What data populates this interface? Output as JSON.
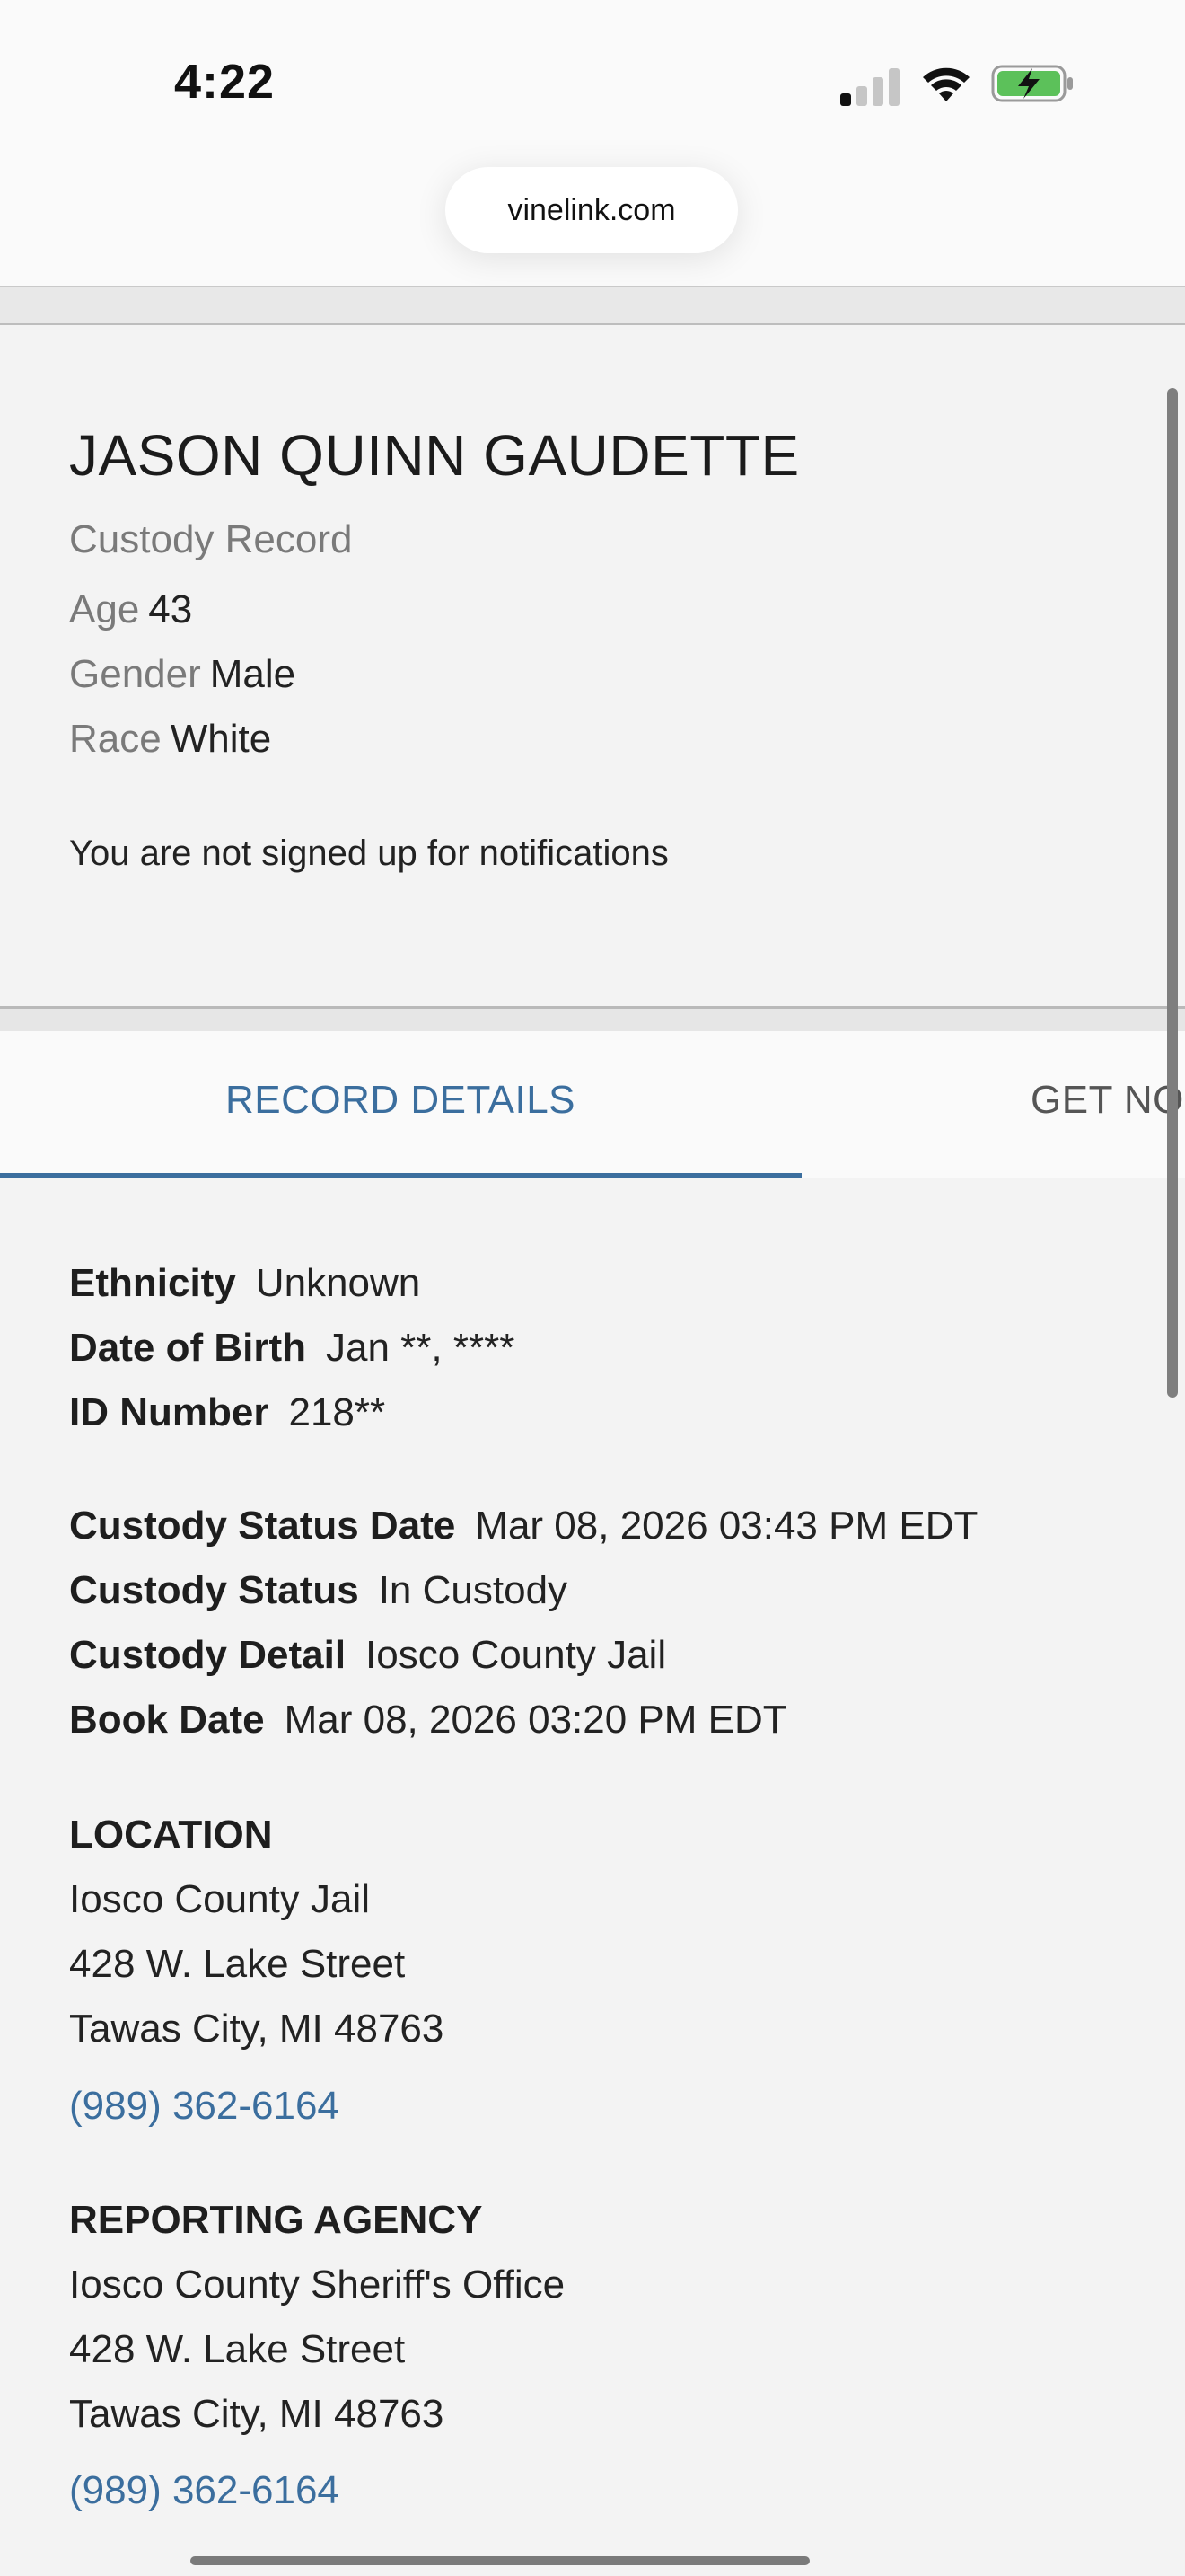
{
  "status_bar": {
    "time": "4:22"
  },
  "browser": {
    "url": "vinelink.com"
  },
  "record": {
    "name": "JASON QUINN GAUDETTE",
    "subtitle": "Custody Record",
    "age_label": "Age",
    "age_value": "43",
    "gender_label": "Gender",
    "gender_value": "Male",
    "race_label": "Race",
    "race_value": "White",
    "notice": "You are not signed up for notifications"
  },
  "tabs": [
    {
      "label": "RECORD DETAILS",
      "active": true
    },
    {
      "label": "GET NO"
    }
  ],
  "details": {
    "ethnicity_label": "Ethnicity",
    "ethnicity_value": "Unknown",
    "dob_label": "Date of Birth",
    "dob_value": "Jan **, ****",
    "id_label": "ID Number",
    "id_value": "218**",
    "custody_status_date_label": "Custody Status Date",
    "custody_status_date_value": "Mar 08, 2026 03:43 PM EDT",
    "custody_status_label": "Custody Status",
    "custody_status_value": "In Custody",
    "custody_detail_label": "Custody Detail",
    "custody_detail_value": "Iosco County Jail",
    "book_date_label": "Book Date",
    "book_date_value": "Mar 08, 2026 03:20 PM EDT"
  },
  "location": {
    "title": "LOCATION",
    "name": "Iosco County Jail",
    "street": "428 W. Lake Street",
    "city": "Tawas City, MI 48763",
    "phone": "(989) 362-6164"
  },
  "reporting_agency": {
    "title": "REPORTING AGENCY",
    "name": "Iosco County Sheriff's Office",
    "street": "428 W. Lake Street",
    "city": "Tawas City, MI 48763",
    "phone": "(989) 362-6164"
  },
  "colors": {
    "accent": "#3b6e9e",
    "muted": "#7a7a7a",
    "battery_fill": "#5cc15a"
  },
  "icons": [
    "cellular-signal-icon",
    "wifi-icon",
    "battery-charging-icon"
  ]
}
